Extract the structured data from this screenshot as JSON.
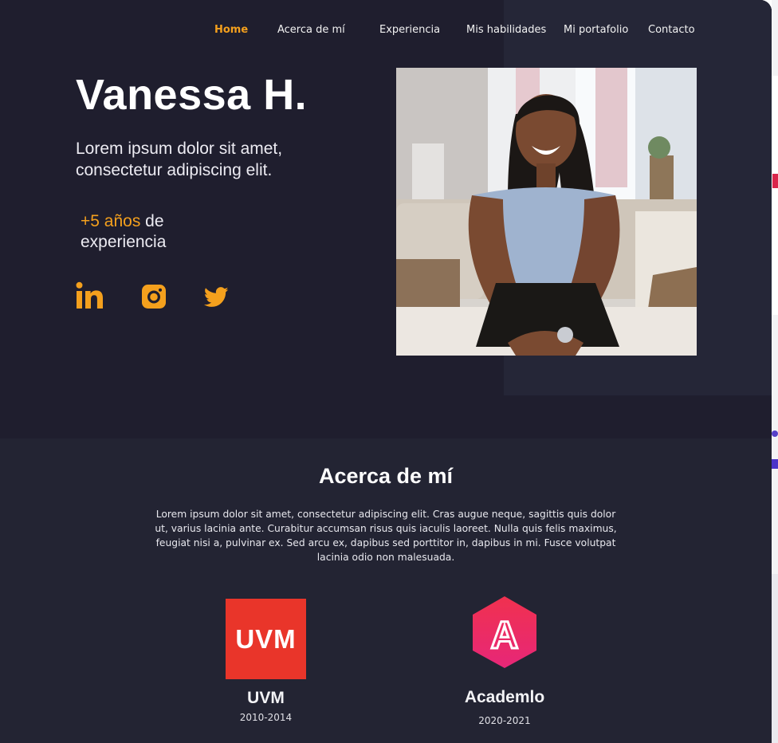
{
  "nav": {
    "items": [
      "Home",
      "Acerca de mí",
      "Experiencia",
      "Mis habilidades",
      "Mi portafolio",
      "Contacto"
    ],
    "active": "Home"
  },
  "hero": {
    "name": "Vanessa H.",
    "tagline": "Lorem ipsum dolor sit amet, consectetur adipiscing elit.",
    "experience_highlight": "+5 años",
    "experience_rest": "de experiencia",
    "social": {
      "linkedin_icon": "linkedin-icon",
      "instagram_icon": "instagram-icon",
      "twitter_icon": "twitter-icon",
      "color": "#f4a01d"
    }
  },
  "about": {
    "title": "Acerca de mí",
    "text": "Lorem ipsum dolor sit amet, consectetur adipiscing elit. Cras augue neque, sagittis quis dolor ut, varius lacinia ante. Curabitur accumsan risus quis iaculis laoreet. Nulla quis felis maximus, feugiat nisi a, pulvinar ex. Sed arcu ex, dapibus sed porttitor in, dapibus in mi. Fusce volutpat lacinia odio non malesuada.",
    "education": [
      {
        "logo_text": "UVM",
        "name": "UVM",
        "years": "2010-2014",
        "logo_color": "#e9352a"
      },
      {
        "logo_text": "A",
        "name": "Academlo",
        "years": "2020-2021",
        "logo_color": "#ea2c62"
      }
    ]
  },
  "colors": {
    "accent": "#f4a01d",
    "hero_bg": "#1f1e2e",
    "section_bg": "#232433"
  }
}
